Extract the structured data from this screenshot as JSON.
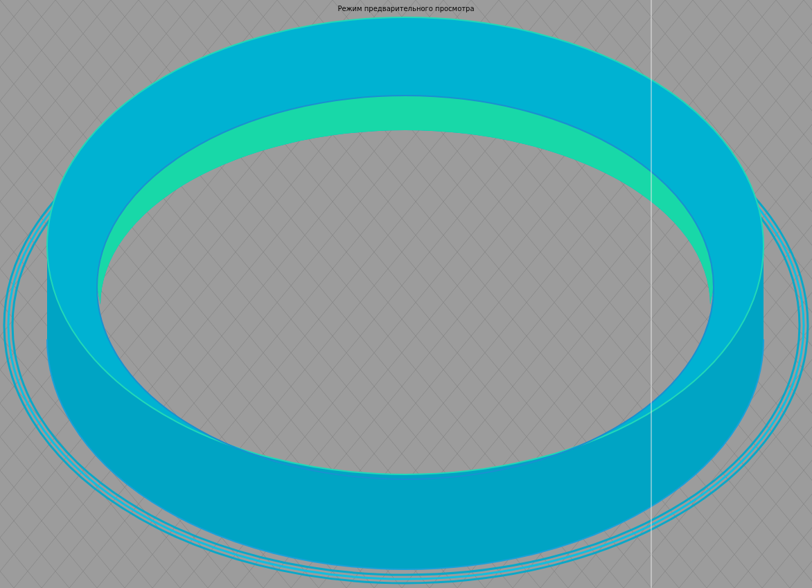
{
  "viewport": {
    "title": "Режим предварительного просмотра"
  }
}
